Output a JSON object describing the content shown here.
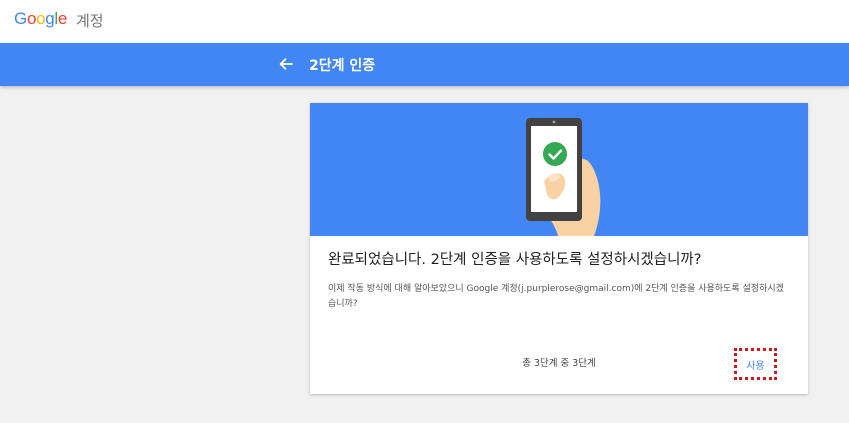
{
  "brand": {
    "logo_letters": [
      {
        "ch": "G",
        "color": "#4285f4"
      },
      {
        "ch": "o",
        "color": "#ea4335"
      },
      {
        "ch": "o",
        "color": "#fbbc05"
      },
      {
        "ch": "g",
        "color": "#4285f4"
      },
      {
        "ch": "l",
        "color": "#34a853"
      },
      {
        "ch": "e",
        "color": "#ea4335"
      }
    ],
    "product": "계정"
  },
  "header": {
    "back_icon": "arrow-left-icon",
    "title": "2단계 인증"
  },
  "card": {
    "illustration_icon": "phone-check-icon",
    "heading": "완료되었습니다. 2단계 인증을 사용하도록 설정하시겠습니까?",
    "description": "이제 작동 방식에 대해 알아보았으니 Google 계정(j.purplerose@gmail.com)에 2단계 인증을 사용하도록 설정하시겠습니까?",
    "step_text": "총 3단계 중 3단계",
    "action_label": "사용"
  },
  "colors": {
    "accent": "#4285f4",
    "check_green": "#34a853",
    "highlight": "#c91b1b"
  }
}
